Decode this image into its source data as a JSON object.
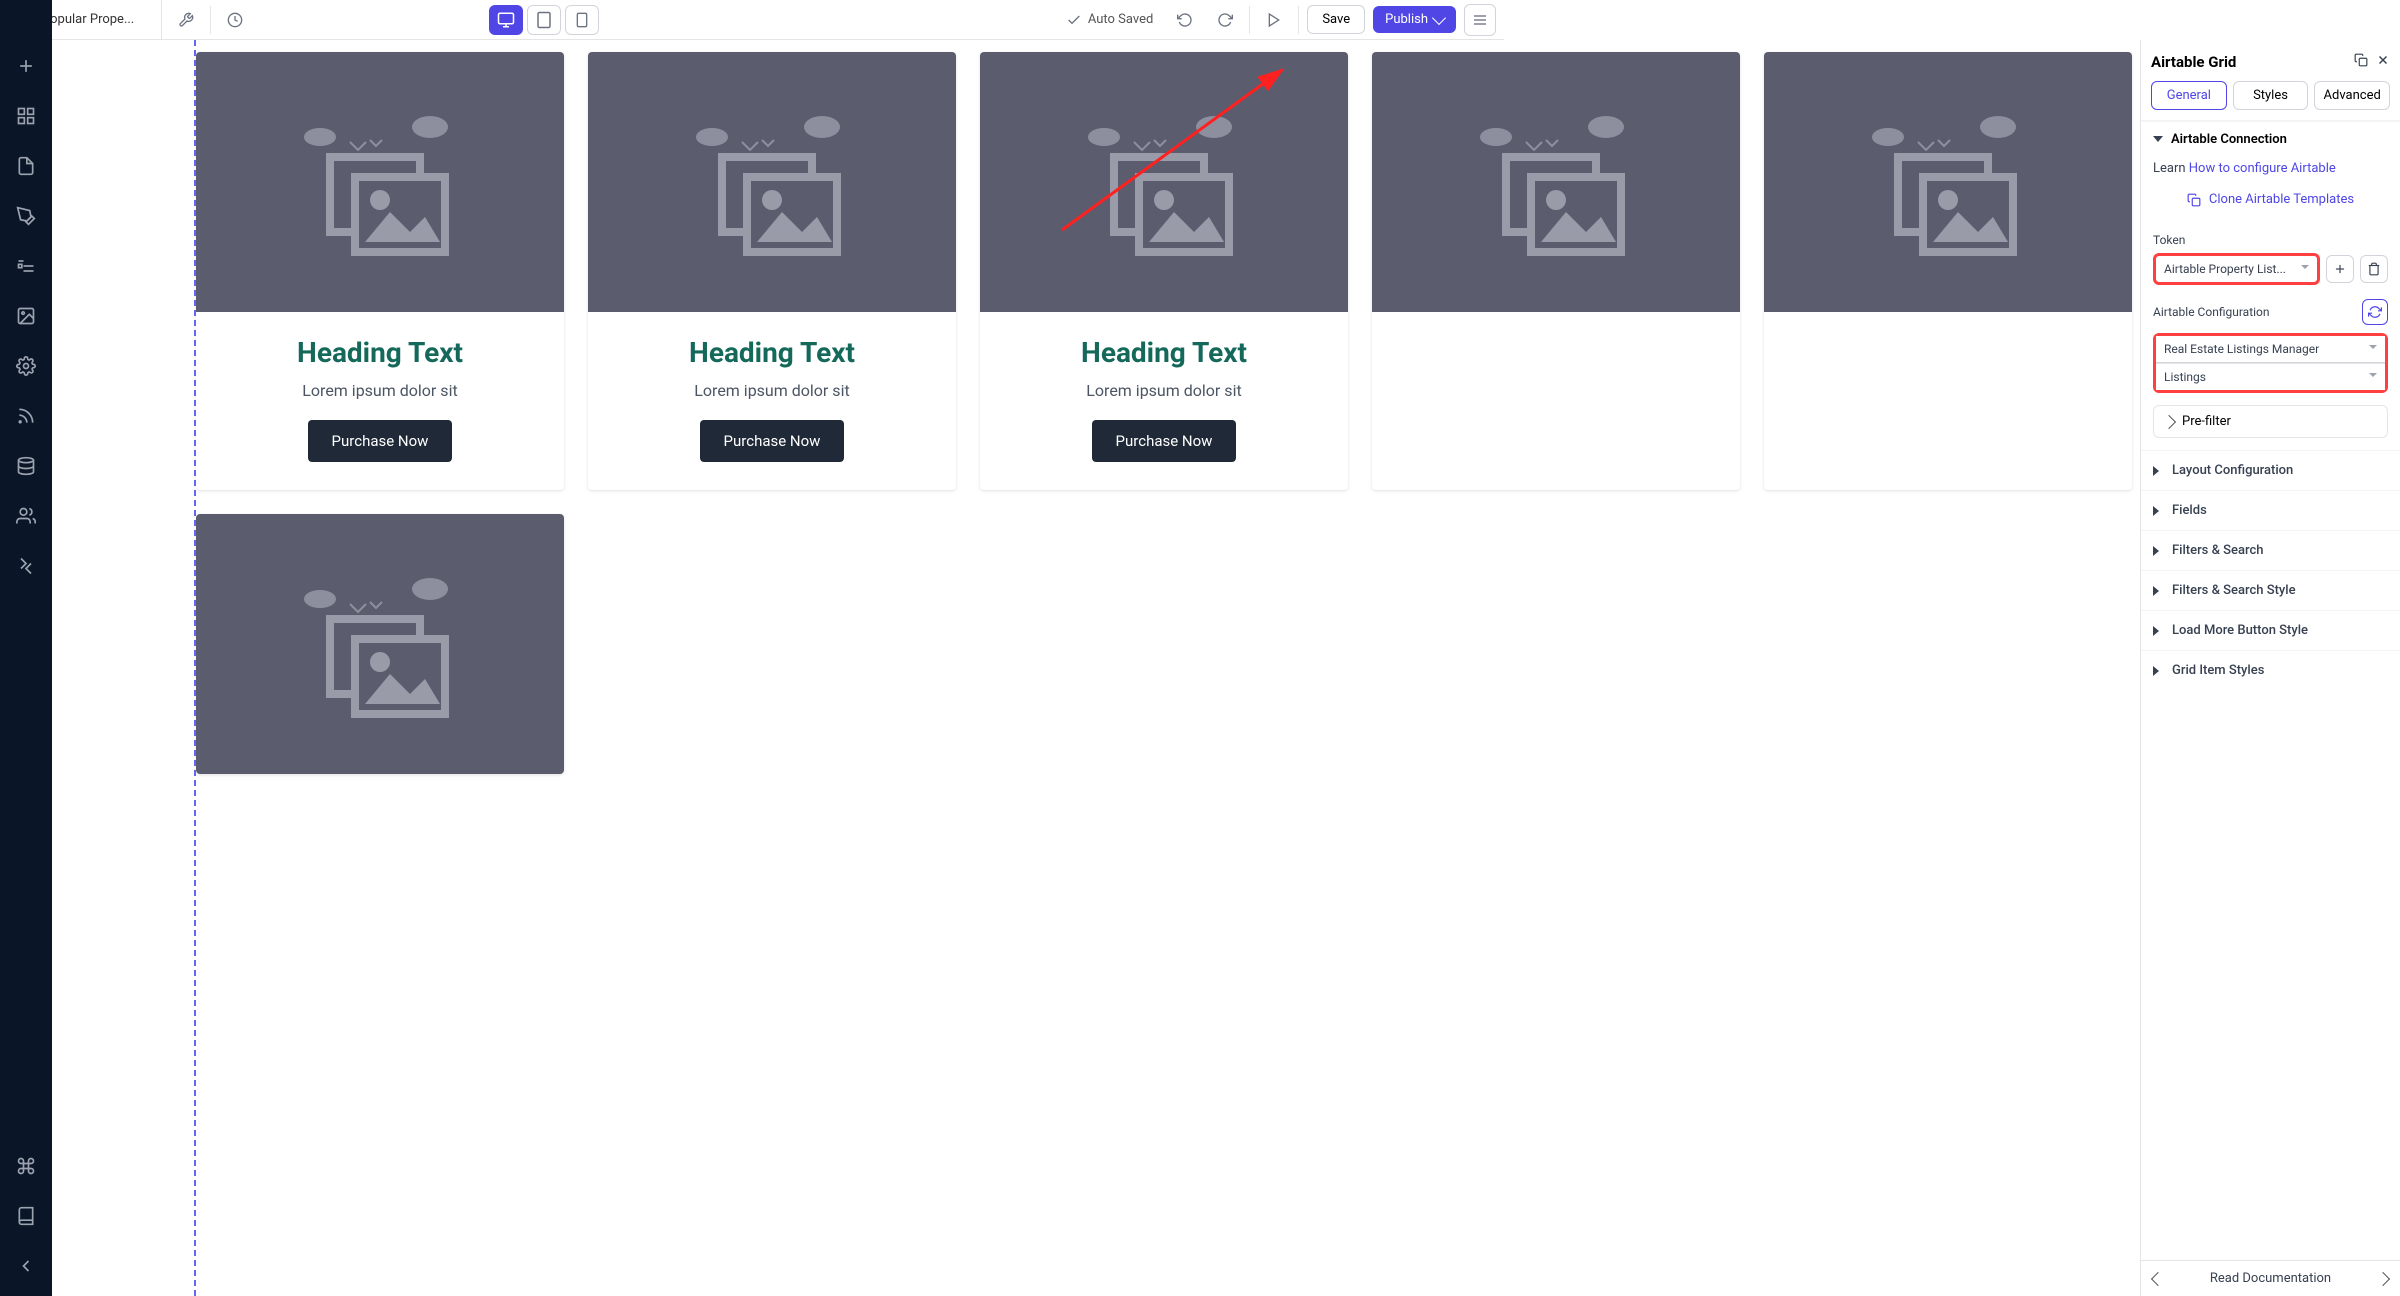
{
  "topbar": {
    "page_name": "Popular Prope...",
    "autosaved": "Auto Saved",
    "save": "Save",
    "publish": "Publish"
  },
  "card": {
    "heading": "Heading Text",
    "text": "Lorem ipsum dolor sit",
    "button": "Purchase Now"
  },
  "panel": {
    "title": "Airtable Grid",
    "tabs": {
      "general": "General",
      "styles": "Styles",
      "advanced": "Advanced"
    },
    "sections": {
      "connection": "Airtable Connection",
      "learn_prefix": "Learn ",
      "learn_link": "How to configure Airtable",
      "clone": "Clone Airtable Templates",
      "token_label": "Token",
      "token_value": "Airtable Property List...",
      "config_label": "Airtable Configuration",
      "config_base": "Real Estate Listings Manager",
      "config_table": "Listings",
      "prefilter": "Pre-filter",
      "layout": "Layout Configuration",
      "fields": "Fields",
      "filters_search": "Filters & Search",
      "filters_style": "Filters & Search Style",
      "loadmore": "Load More Button Style",
      "griditem": "Grid Item Styles"
    },
    "footer": "Read Documentation"
  }
}
